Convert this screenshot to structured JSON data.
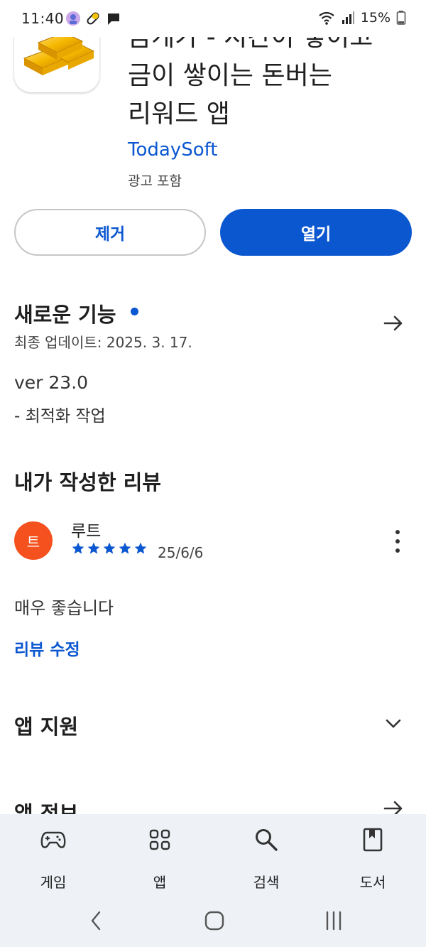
{
  "status_bar": {
    "time": "11:40",
    "battery": "15%"
  },
  "app": {
    "title_lines": [
      "금게가 - 시간이 쌓이고",
      "금이 쌓이는 돈버는",
      "리워드 앱"
    ],
    "developer": "TodaySoft",
    "ads_note": "광고 포함"
  },
  "buttons": {
    "uninstall": "제거",
    "open": "열기"
  },
  "whats_new": {
    "title": "새로운 기능",
    "updated": "최종 업데이트: 2025. 3. 17.",
    "version": "ver 23.0",
    "note": "- 최적화 작업"
  },
  "my_review": {
    "title": "내가 작성한 리뷰",
    "avatar_letter": "트",
    "reviewer": "루트",
    "rating": 5,
    "date": "25/6/6",
    "text": "매우 좋습니다",
    "edit_label": "리뷰 수정"
  },
  "app_support": {
    "title": "앱 지원"
  },
  "app_info": {
    "title": "앱 정보"
  },
  "bottom_nav": [
    {
      "label": "게임",
      "icon": "gamepad-icon"
    },
    {
      "label": "앱",
      "icon": "apps-grid-icon"
    },
    {
      "label": "검색",
      "icon": "search-icon"
    },
    {
      "label": "도서",
      "icon": "book-icon"
    }
  ],
  "colors": {
    "accent": "#0b57d0",
    "avatar": "#f4511e",
    "nav_background": "#eef2f7"
  }
}
